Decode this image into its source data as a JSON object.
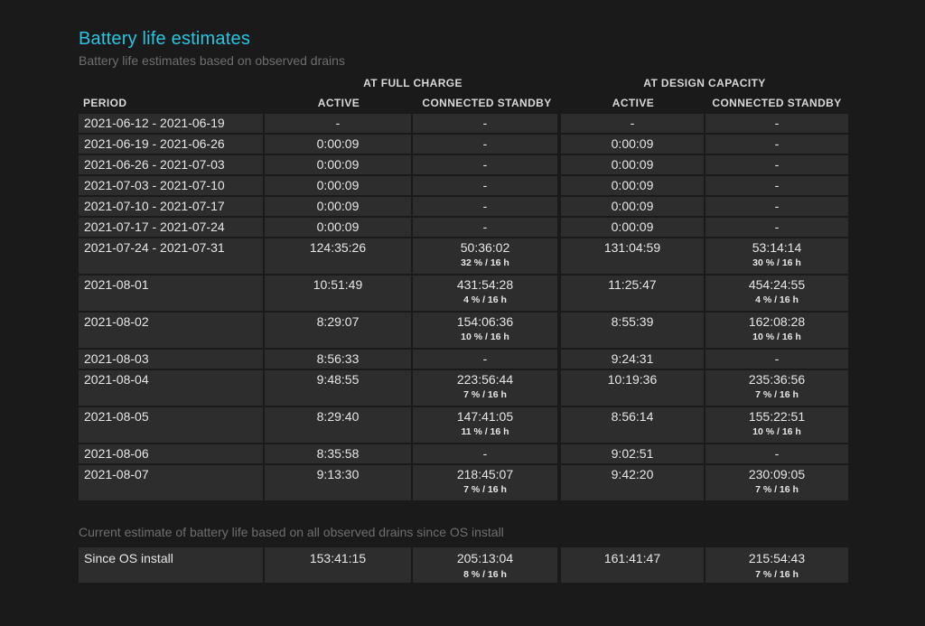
{
  "title": "Battery life estimates",
  "subtitle": "Battery life estimates based on observed drains",
  "headers": {
    "group_full": "AT FULL CHARGE",
    "group_design": "AT DESIGN CAPACITY",
    "period": "PERIOD",
    "active": "ACTIVE",
    "standby": "CONNECTED STANDBY"
  },
  "rows": [
    {
      "period": "2021-06-12 - 2021-06-19",
      "full_active": "-",
      "full_standby": "-",
      "full_standby_sub": "",
      "design_active": "-",
      "design_standby": "-",
      "design_standby_sub": ""
    },
    {
      "period": "2021-06-19 - 2021-06-26",
      "full_active": "0:00:09",
      "full_standby": "-",
      "full_standby_sub": "",
      "design_active": "0:00:09",
      "design_standby": "-",
      "design_standby_sub": ""
    },
    {
      "period": "2021-06-26 - 2021-07-03",
      "full_active": "0:00:09",
      "full_standby": "-",
      "full_standby_sub": "",
      "design_active": "0:00:09",
      "design_standby": "-",
      "design_standby_sub": ""
    },
    {
      "period": "2021-07-03 - 2021-07-10",
      "full_active": "0:00:09",
      "full_standby": "-",
      "full_standby_sub": "",
      "design_active": "0:00:09",
      "design_standby": "-",
      "design_standby_sub": ""
    },
    {
      "period": "2021-07-10 - 2021-07-17",
      "full_active": "0:00:09",
      "full_standby": "-",
      "full_standby_sub": "",
      "design_active": "0:00:09",
      "design_standby": "-",
      "design_standby_sub": ""
    },
    {
      "period": "2021-07-17 - 2021-07-24",
      "full_active": "0:00:09",
      "full_standby": "-",
      "full_standby_sub": "",
      "design_active": "0:00:09",
      "design_standby": "-",
      "design_standby_sub": ""
    },
    {
      "period": "2021-07-24 - 2021-07-31",
      "full_active": "124:35:26",
      "full_standby": "50:36:02",
      "full_standby_sub": "32 % / 16 h",
      "design_active": "131:04:59",
      "design_standby": "53:14:14",
      "design_standby_sub": "30 % / 16 h"
    },
    {
      "period": "2021-08-01",
      "full_active": "10:51:49",
      "full_standby": "431:54:28",
      "full_standby_sub": "4 % / 16 h",
      "design_active": "11:25:47",
      "design_standby": "454:24:55",
      "design_standby_sub": "4 % / 16 h"
    },
    {
      "period": "2021-08-02",
      "full_active": "8:29:07",
      "full_standby": "154:06:36",
      "full_standby_sub": "10 % / 16 h",
      "design_active": "8:55:39",
      "design_standby": "162:08:28",
      "design_standby_sub": "10 % / 16 h"
    },
    {
      "period": "2021-08-03",
      "full_active": "8:56:33",
      "full_standby": "-",
      "full_standby_sub": "",
      "design_active": "9:24:31",
      "design_standby": "-",
      "design_standby_sub": ""
    },
    {
      "period": "2021-08-04",
      "full_active": "9:48:55",
      "full_standby": "223:56:44",
      "full_standby_sub": "7 % / 16 h",
      "design_active": "10:19:36",
      "design_standby": "235:36:56",
      "design_standby_sub": "7 % / 16 h"
    },
    {
      "period": "2021-08-05",
      "full_active": "8:29:40",
      "full_standby": "147:41:05",
      "full_standby_sub": "11 % / 16 h",
      "design_active": "8:56:14",
      "design_standby": "155:22:51",
      "design_standby_sub": "10 % / 16 h"
    },
    {
      "period": "2021-08-06",
      "full_active": "8:35:58",
      "full_standby": "-",
      "full_standby_sub": "",
      "design_active": "9:02:51",
      "design_standby": "-",
      "design_standby_sub": ""
    },
    {
      "period": "2021-08-07",
      "full_active": "9:13:30",
      "full_standby": "218:45:07",
      "full_standby_sub": "7 % / 16 h",
      "design_active": "9:42:20",
      "design_standby": "230:09:05",
      "design_standby_sub": "7 % / 16 h"
    }
  ],
  "os_caption": "Current estimate of battery life based on all observed drains since OS install",
  "os_row": {
    "period": "Since OS install",
    "full_active": "153:41:15",
    "full_standby": "205:13:04",
    "full_standby_sub": "8 % / 16 h",
    "design_active": "161:41:47",
    "design_standby": "215:54:43",
    "design_standby_sub": "7 % / 16 h"
  }
}
